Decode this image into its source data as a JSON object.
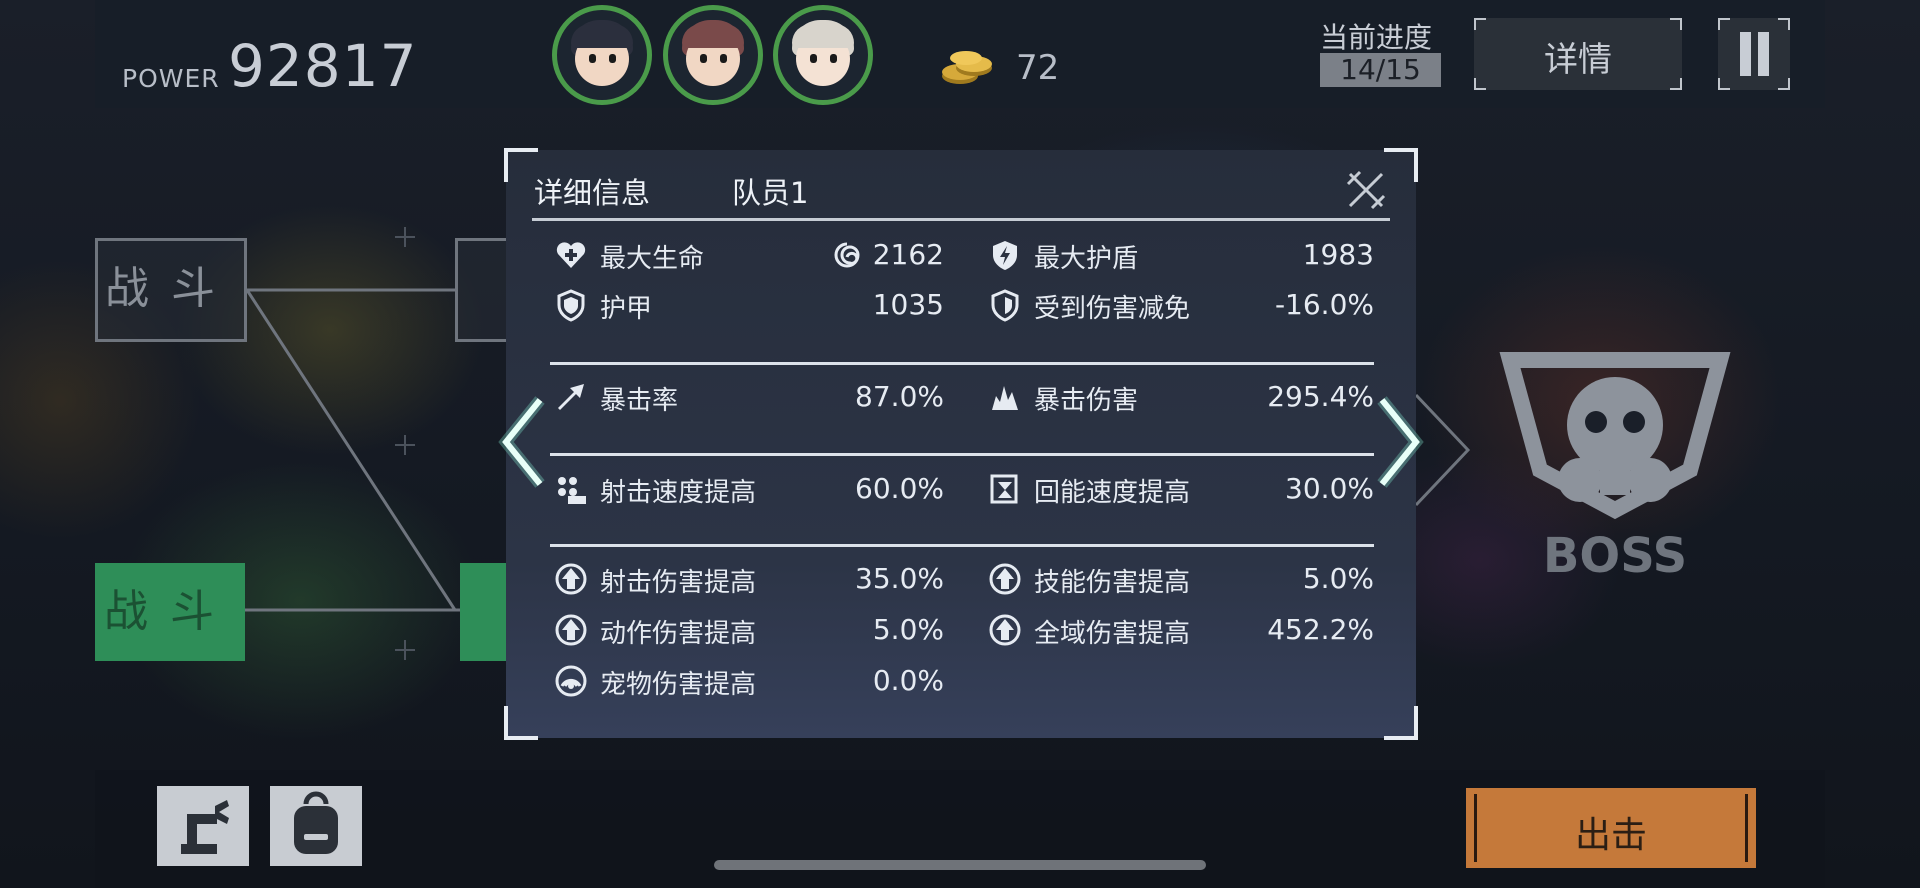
{
  "topbar": {
    "power_label": "POWER",
    "power_value": "92817",
    "coin_icon": "gold-coins-icon",
    "coin_count": "72",
    "progress_label": "当前进度",
    "progress_value": "14/15",
    "details_label": "详情",
    "pause_icon": "pause-icon"
  },
  "team": [
    {
      "name": "team-member-1-avatar",
      "ring": "#4a9b4a"
    },
    {
      "name": "team-member-2-avatar",
      "ring": "#4a9b4a"
    },
    {
      "name": "team-member-3-avatar",
      "ring": "#4a9b4a"
    }
  ],
  "map": {
    "node_1_label": "战斗",
    "node_2_label": "战斗",
    "boss_label": "BOSS"
  },
  "modal": {
    "title": "详细信息",
    "subtitle": "队员1",
    "stats": {
      "max_hp_label": "最大生命",
      "max_hp_value": "2162",
      "max_shield_label": "最大护盾",
      "max_shield_value": "1983",
      "armor_label": "护甲",
      "armor_value": "1035",
      "dmg_reduction_label": "受到伤害减免",
      "dmg_reduction_value": "-16.0%",
      "crit_rate_label": "暴击率",
      "crit_rate_value": "87.0%",
      "crit_dmg_label": "暴击伤害",
      "crit_dmg_value": "295.4%",
      "fire_rate_label": "射击速度提高",
      "fire_rate_value": "60.0%",
      "energy_regen_label": "回能速度提高",
      "energy_regen_value": "30.0%",
      "shoot_dmg_label": "射击伤害提高",
      "shoot_dmg_value": "35.0%",
      "skill_dmg_label": "技能伤害提高",
      "skill_dmg_value": "5.0%",
      "action_dmg_label": "动作伤害提高",
      "action_dmg_value": "5.0%",
      "global_dmg_label": "全域伤害提高",
      "global_dmg_value": "452.2%",
      "pet_dmg_label": "宠物伤害提高",
      "pet_dmg_value": "0.0%"
    }
  },
  "bottom": {
    "build_icon": "robot-arm-icon",
    "backpack_icon": "backpack-icon",
    "sortie_label": "出击"
  },
  "colors": {
    "accent_teal": "#7fe0c8",
    "sortie_orange": "#c5793a",
    "battle_green": "#2e8e58"
  }
}
